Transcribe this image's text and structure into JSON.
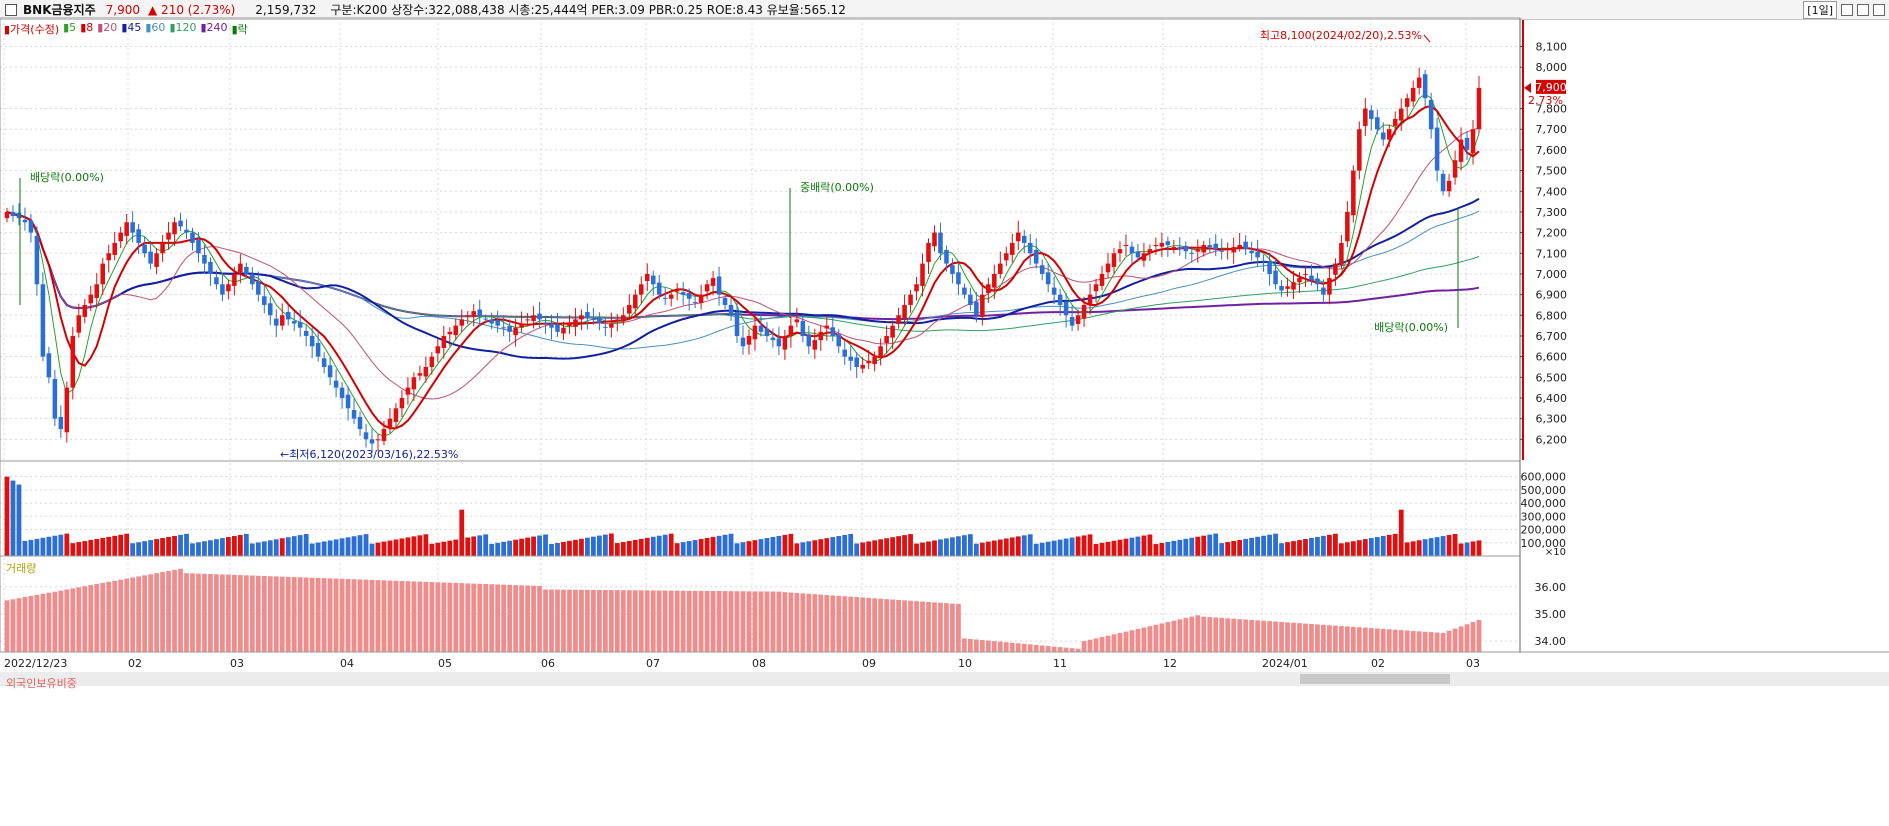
{
  "header": {
    "name": "BNK금융지주",
    "price": "7,900",
    "change": "▲ 210",
    "change_pct": "(2.73%)",
    "volume": "2,159,732",
    "info": "구분:K200  상장수:322,088,438  시총:25,444억  PER:3.09  PBR:0.25  ROE:8.43  유보율:565.12",
    "period": "[1일]"
  },
  "legend": [
    {
      "label": "가격(수정)",
      "color": "#d40000"
    },
    {
      "label": "5",
      "color": "#2aa02a"
    },
    {
      "label": "8",
      "color": "#d40000"
    },
    {
      "label": "20",
      "color": "#c05078"
    },
    {
      "label": "45",
      "color": "#1020a0"
    },
    {
      "label": "60",
      "color": "#4a90c0"
    },
    {
      "label": "120",
      "color": "#30a060"
    },
    {
      "label": "240",
      "color": "#7020a0"
    },
    {
      "label": "락",
      "color": "#0a7a0a"
    }
  ],
  "colors": {
    "up": "#e01010",
    "down": "#2b6fd6",
    "foreign": "#f08c8c",
    "grid": "#d8d8d8"
  },
  "annotations": {
    "high": "최고8,100(2024/02/20),2.53%",
    "low": "최저6,120(2023/03/16),22.53%",
    "div1": "배당락(0.00%)",
    "div2": "중배락(0.00%)",
    "div3": "배당락(0.00%)"
  },
  "price_tag": {
    "price": "7,900",
    "pct": "2.73%"
  },
  "panels": {
    "volume_title": "거래량",
    "volume_unit": "×10",
    "foreign_title": "외국인보유비중"
  },
  "chart_data": [
    {
      "type": "candlestick",
      "title": "",
      "x_labels": [
        "2022/12/23",
        "02",
        "03",
        "04",
        "05",
        "06",
        "07",
        "08",
        "09",
        "10",
        "11",
        "12",
        "2024/01",
        "02",
        "03"
      ],
      "y_ticks": [
        6200,
        6300,
        6400,
        6500,
        6600,
        6700,
        6800,
        6900,
        7000,
        7100,
        7200,
        7300,
        7400,
        7500,
        7600,
        7700,
        7800,
        8000,
        8100
      ],
      "ylim": [
        6100,
        8180
      ],
      "grid": true,
      "series_close": [
        7300,
        7280,
        7270,
        7250,
        7200,
        6950,
        6600,
        6500,
        6300,
        6250,
        6450,
        6700,
        6800,
        6850,
        6900,
        6950,
        7050,
        7100,
        7150,
        7200,
        7250,
        7200,
        7150,
        7100,
        7050,
        7100,
        7150,
        7200,
        7250,
        7230,
        7200,
        7150,
        7100,
        7050,
        7000,
        6950,
        6900,
        6950,
        7000,
        7050,
        7000,
        6950,
        6900,
        6850,
        6800,
        6750,
        6800,
        6780,
        6760,
        6740,
        6700,
        6650,
        6600,
        6550,
        6500,
        6450,
        6400,
        6350,
        6300,
        6250,
        6200,
        6180,
        6200,
        6250,
        6300,
        6350,
        6400,
        6450,
        6500,
        6520,
        6550,
        6600,
        6650,
        6700,
        6720,
        6750,
        6780,
        6800,
        6820,
        6800,
        6780,
        6760,
        6750,
        6740,
        6720,
        6740,
        6760,
        6780,
        6800,
        6780,
        6760,
        6740,
        6720,
        6740,
        6760,
        6780,
        6800,
        6790,
        6780,
        6760,
        6740,
        6760,
        6780,
        6800,
        6850,
        6900,
        6950,
        7000,
        6950,
        6900,
        6880,
        6900,
        6920,
        6900,
        6880,
        6860,
        6900,
        6950,
        6980,
        6900,
        6850,
        6800,
        6700,
        6650,
        6700,
        6750,
        6720,
        6700,
        6680,
        6650,
        6700,
        6750,
        6780,
        6700,
        6650,
        6680,
        6720,
        6750,
        6700,
        6650,
        6600,
        6580,
        6550,
        6560,
        6580,
        6600,
        6650,
        6700,
        6750,
        6800,
        6850,
        6900,
        6950,
        7050,
        7150,
        7200,
        7100,
        7050,
        7000,
        6950,
        6900,
        6850,
        6800,
        6900,
        6950,
        7000,
        7050,
        7100,
        7150,
        7200,
        7150,
        7100,
        7050,
        7000,
        6950,
        6900,
        6850,
        6800,
        6750,
        6800,
        6850,
        6900,
        6950,
        7000,
        7050,
        7100,
        7120,
        7140,
        7100,
        7080,
        7100,
        7120,
        7140,
        7150,
        7140,
        7130,
        7120,
        7110,
        7100,
        7120,
        7140,
        7130,
        7120,
        7110,
        7120,
        7130,
        7140,
        7120,
        7100,
        7080,
        7060,
        7000,
        6950,
        6920,
        6940,
        6960,
        6980,
        7000,
        6970,
        6950,
        6900,
        6980,
        7050,
        7150,
        7300,
        7500,
        7700,
        7800,
        7750,
        7700,
        7650,
        7700,
        7750,
        7800,
        7850,
        7900,
        7950,
        7850,
        7700,
        7500,
        7400,
        7450,
        7550,
        7650,
        7600,
        7700,
        7900
      ],
      "volume_ticks": [
        100000,
        200000,
        300000,
        400000,
        500000,
        600000
      ],
      "volume_ylim": [
        0,
        650000
      ],
      "foreign_ticks": [
        34.0,
        35.0,
        36.0
      ],
      "foreign_ylim": [
        33.6,
        36.8
      ]
    }
  ]
}
